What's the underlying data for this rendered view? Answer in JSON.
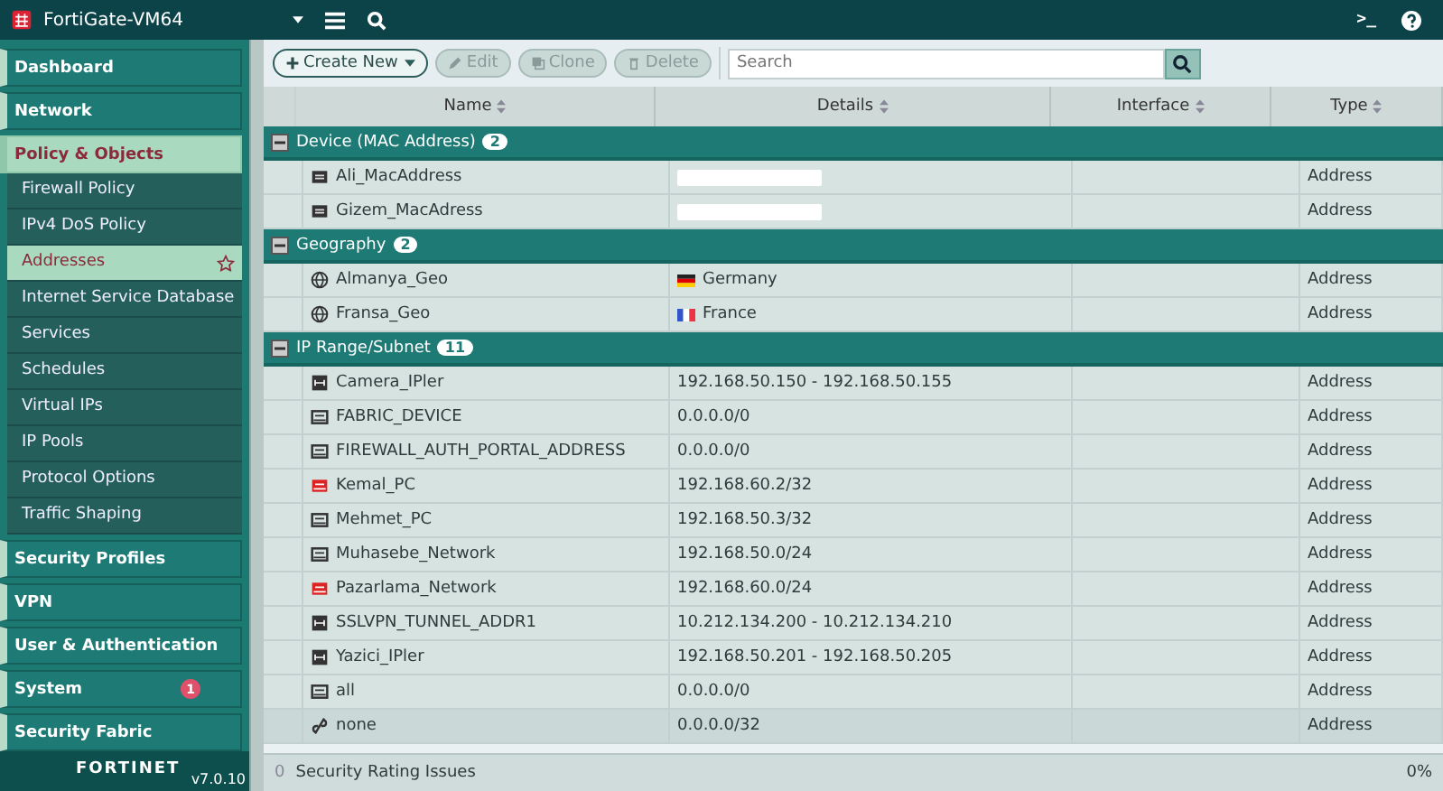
{
  "topbar": {
    "device": "FortiGate-VM64",
    "cli_icon": ">_"
  },
  "sidebar": {
    "items": [
      {
        "label": "Dashboard",
        "expanded": false
      },
      {
        "label": "Network",
        "expanded": false
      },
      {
        "label": "Policy & Objects",
        "expanded": true,
        "children": [
          {
            "label": "Firewall Policy",
            "selected": false
          },
          {
            "label": "IPv4 DoS Policy",
            "selected": false
          },
          {
            "label": "Addresses",
            "selected": true
          },
          {
            "label": "Internet Service Database",
            "selected": false
          },
          {
            "label": "Services",
            "selected": false
          },
          {
            "label": "Schedules",
            "selected": false
          },
          {
            "label": "Virtual IPs",
            "selected": false
          },
          {
            "label": "IP Pools",
            "selected": false
          },
          {
            "label": "Protocol Options",
            "selected": false
          },
          {
            "label": "Traffic Shaping",
            "selected": false
          }
        ]
      },
      {
        "label": "Security Profiles",
        "expanded": false
      },
      {
        "label": "VPN",
        "expanded": false
      },
      {
        "label": "User & Authentication",
        "expanded": false
      },
      {
        "label": "System",
        "expanded": false,
        "badge": "1"
      },
      {
        "label": "Security Fabric",
        "expanded": false
      }
    ],
    "logo": "FORTINET",
    "version": "v7.0.10"
  },
  "toolbar": {
    "buttons": [
      {
        "label": "Create New",
        "kind": "create",
        "disabled": false
      },
      {
        "label": "Edit",
        "kind": "edit",
        "disabled": true
      },
      {
        "label": "Clone",
        "kind": "clone",
        "disabled": true
      },
      {
        "label": "Delete",
        "kind": "delete",
        "disabled": true
      }
    ],
    "search": {
      "placeholder": "Search"
    }
  },
  "table": {
    "columns": [
      "Name",
      "Details",
      "Interface",
      "Type"
    ],
    "groups": [
      {
        "title": "Device (MAC Address)",
        "count": "2",
        "expanded": true,
        "rows": [
          {
            "kind": "mac",
            "name": "Ali_MacAddress",
            "details_redacted": true,
            "type": "Address"
          },
          {
            "kind": "mac",
            "name": "Gizem_MacAdress",
            "details_redacted": true,
            "type": "Address"
          }
        ]
      },
      {
        "title": "Geography",
        "count": "2",
        "expanded": true,
        "rows": [
          {
            "kind": "geo",
            "name": "Almanya_Geo",
            "details": "Germany",
            "flag": {
              "kind": "germany"
            },
            "type": "Address"
          },
          {
            "kind": "geo",
            "name": "Fransa_Geo",
            "details": "France",
            "flag": {
              "kind": "france"
            },
            "type": "Address"
          }
        ]
      },
      {
        "title": "IP Range/Subnet",
        "count": "11",
        "expanded": true,
        "rows": [
          {
            "kind": "range",
            "name": "Camera_IPler",
            "details": "192.168.50.150 - 192.168.50.155",
            "type": "Address"
          },
          {
            "kind": "subnet",
            "name": "FABRIC_DEVICE",
            "details": "0.0.0.0/0",
            "type": "Address"
          },
          {
            "kind": "subnet",
            "name": "FIREWALL_AUTH_PORTAL_ADDRESS",
            "details": "0.0.0.0/0",
            "type": "Address"
          },
          {
            "kind": "subnet-red",
            "name": "Kemal_PC",
            "details": "192.168.60.2/32",
            "type": "Address"
          },
          {
            "kind": "subnet",
            "name": "Mehmet_PC",
            "details": "192.168.50.3/32",
            "type": "Address"
          },
          {
            "kind": "subnet",
            "name": "Muhasebe_Network",
            "details": "192.168.50.0/24",
            "type": "Address"
          },
          {
            "kind": "subnet-red",
            "name": "Pazarlama_Network",
            "details": "192.168.60.0/24",
            "type": "Address"
          },
          {
            "kind": "range",
            "name": "SSLVPN_TUNNEL_ADDR1",
            "details": "10.212.134.200 - 10.212.134.210",
            "type": "Address"
          },
          {
            "kind": "range",
            "name": "Yazici_IPler",
            "details": "192.168.50.201 - 192.168.50.205",
            "type": "Address"
          },
          {
            "kind": "subnet",
            "name": "all",
            "details": "0.0.0.0/0",
            "type": "Address"
          },
          {
            "kind": "none",
            "name": "none",
            "details": "0.0.0.0/32",
            "type": "Address"
          }
        ]
      }
    ]
  },
  "status_bar": {
    "count": "0",
    "label": "Security Rating Issues",
    "percent": "0%"
  }
}
